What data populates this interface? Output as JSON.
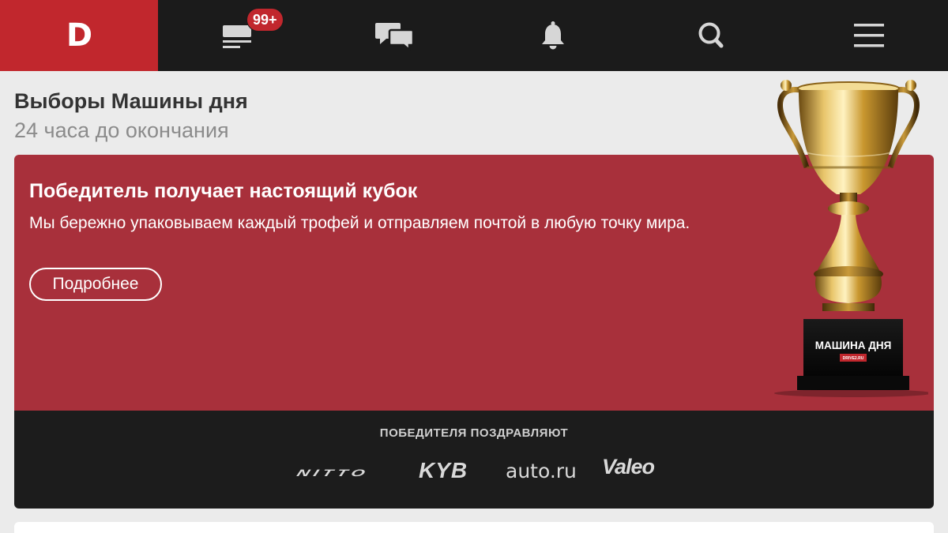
{
  "nav": {
    "logo": "D",
    "badge": "99+",
    "items": [
      {
        "icon": "feed-icon"
      },
      {
        "icon": "chat-icon"
      },
      {
        "icon": "bell-icon"
      },
      {
        "icon": "search-icon"
      },
      {
        "icon": "menu-icon"
      }
    ]
  },
  "header": {
    "title": "Выборы Машины дня",
    "subtitle": "24 часа до окончания"
  },
  "promo": {
    "heading": "Победитель получает настоящий кубок",
    "text": "Мы бережно упаковываем каждый трофей и отправляем почтой в любую точку мира.",
    "button": "Подробнее",
    "trophy_plaque": "МАШИНА ДНЯ",
    "trophy_plaque_sub": "DRIVE2.RU",
    "congrats": "ПОБЕДИТЕЛЯ ПОЗДРАВЛЯЮТ",
    "sponsors": [
      "NITTO",
      "KYB",
      "auto.ru",
      "Valeo"
    ]
  },
  "colors": {
    "brand_red": "#c1272d",
    "promo_bg": "#a8303b",
    "topbar_bg": "#1b1b1b"
  }
}
